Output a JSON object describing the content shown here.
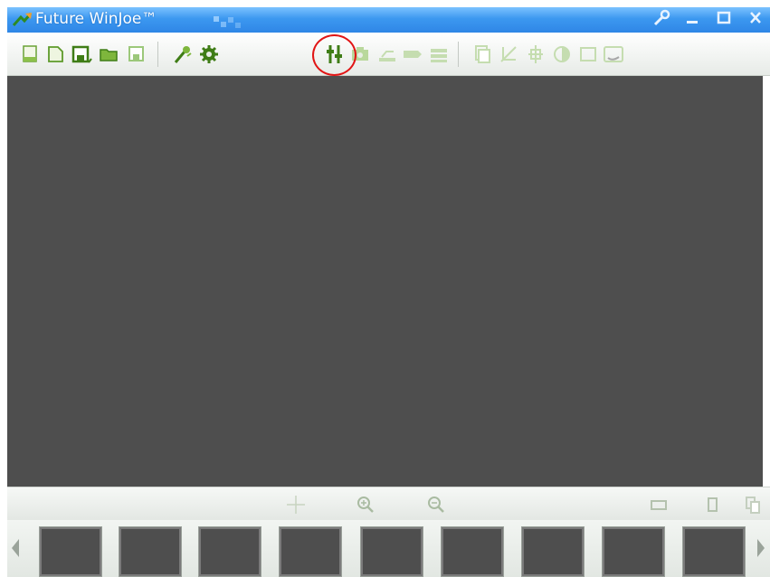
{
  "window": {
    "title": "Future WinJoe™",
    "buttons": [
      "wrench-icon",
      "minimize-icon",
      "maximize-icon",
      "close-icon"
    ]
  },
  "toolbar": {
    "groups": [
      [
        "new-document-icon",
        "open-document-icon",
        "save-as-icon",
        "open-folder-icon",
        "save-icon"
      ],
      [
        "wand-icon",
        "gear-icon",
        "sliders-icon",
        "camera-icon",
        "scan-icon",
        "tag-icon",
        "stack-icon"
      ],
      [
        "copy-icon",
        "crop-icon",
        "resize-icon",
        "contrast-icon",
        "frame-icon",
        "undo-icon"
      ]
    ],
    "highlighted": "sliders-icon",
    "highlight_color": "#e11515"
  },
  "preview": {
    "background": "#4e4e4e"
  },
  "controls": [
    "crosshair-icon",
    "zoom-in-icon",
    "zoom-out-icon",
    "fit-window-icon",
    "single-page-icon",
    "multi-page-icon"
  ],
  "thumbnails": {
    "count": 9
  },
  "colors": {
    "titlebar": "#3c98f0",
    "toolbar_icons": "#4c8a1e"
  }
}
